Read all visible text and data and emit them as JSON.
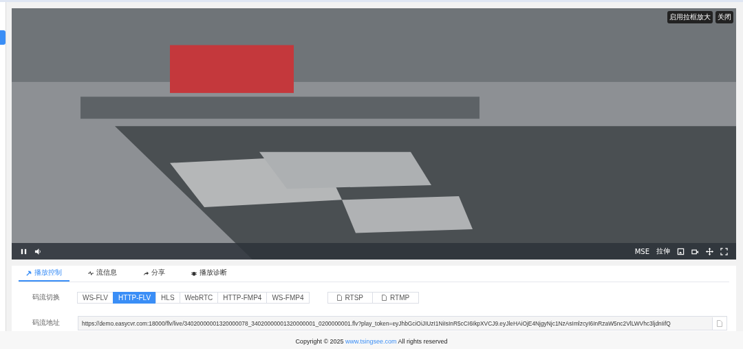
{
  "video": {
    "overlay_buttons": [
      "启用拉框放大",
      "关闭"
    ],
    "playing": true,
    "decoder": "MSE",
    "stretch": "拉伸"
  },
  "tabs": [
    {
      "label": "播放控制",
      "selected": true
    },
    {
      "label": "流信息",
      "selected": false
    },
    {
      "label": "分享",
      "selected": false
    },
    {
      "label": "播放诊断",
      "selected": false
    }
  ],
  "stream_switch": {
    "label": "码流切换",
    "formats": [
      {
        "label": "WS-FLV",
        "selected": false
      },
      {
        "label": "HTTP-FLV",
        "selected": true
      },
      {
        "label": "HLS",
        "selected": false
      },
      {
        "label": "WebRTC",
        "selected": false
      },
      {
        "label": "HTTP-FMP4",
        "selected": false
      },
      {
        "label": "WS-FMP4",
        "selected": false
      }
    ],
    "copy_buttons": [
      "RTSP",
      "RTMP"
    ]
  },
  "stream_url": {
    "label": "码流地址",
    "value": "https://demo.easycvr.com:18000/flv/live/34020000001320000078_34020000001320000001_0200000001.flv?play_token=eyJhbGciOiJIUzI1NiIsInR5cCI6IkpXVCJ9.eyJleHAiOjE4NjgyNjc1NzAsImlzcyI6InRzaW5nc2VlLWVhc3ljdnIifQ"
  },
  "footer": {
    "prefix": "Copyright © 2025 ",
    "link": "www.tsingsee.com",
    "suffix": " All rights reserved"
  }
}
